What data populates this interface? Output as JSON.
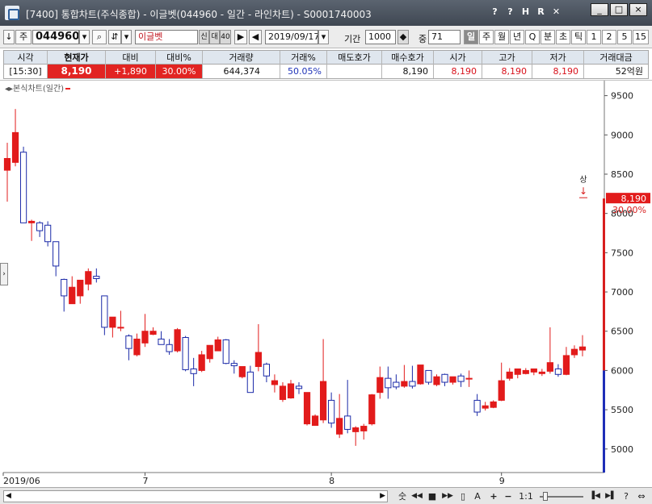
{
  "window": {
    "title": "[7400] 통합차트(주식종합) - 이글벳(044960 - 일간 - 라인차트) - S0001740003",
    "tools": [
      "?",
      "?",
      "H",
      "R",
      "✕"
    ],
    "controls": [
      "_",
      "□",
      "×"
    ]
  },
  "toolbar": {
    "arrow": "↓",
    "stock_type": "주",
    "code": "044960",
    "stock_name": "이글벳",
    "tags": [
      "신",
      "대",
      "40"
    ],
    "date": "2019/09/17",
    "period_label": "기간",
    "period_value": "1000",
    "count_label": "중",
    "count_value": "71",
    "periods": [
      "일",
      "주",
      "월",
      "년",
      "Q",
      "분",
      "초",
      "틱",
      "1",
      "2",
      "5",
      "15"
    ],
    "selected_period": "일"
  },
  "quote": {
    "headers": [
      "시각",
      "현재가",
      "대비",
      "대비%",
      "거래량",
      "거래%",
      "매도호가",
      "매수호가",
      "시가",
      "고가",
      "저가",
      "거래대금"
    ],
    "values": {
      "time": "[15:30]",
      "price": "8,190",
      "change": "+1,890",
      "change_pct": "30.00%",
      "volume": "644,374",
      "volume_pct": "50.05%",
      "ask": "",
      "bid": "8,190",
      "open": "8,190",
      "high": "8,190",
      "low": "8,190",
      "amount": "52억원"
    }
  },
  "chart_data": {
    "type": "candlestick",
    "series_label": "본식차트(일간)",
    "y_ticks": [
      5000,
      5500,
      6000,
      6500,
      7000,
      7500,
      8000,
      8500,
      9000,
      9500
    ],
    "ylim": [
      4700,
      9650
    ],
    "x_labels": [
      {
        "label": "2019/06",
        "index": 0
      },
      {
        "label": "7",
        "index": 17
      },
      {
        "label": "8",
        "index": 40
      },
      {
        "label": "9",
        "index": 61
      }
    ],
    "current_price": 8190,
    "current_price_label": "8,190",
    "current_change_label": "30.00%",
    "limit_label": "상",
    "limit_arrow": "↓",
    "candles": [
      {
        "o": 8550,
        "h": 8900,
        "l": 8150,
        "c": 8700
      },
      {
        "o": 8650,
        "h": 9330,
        "l": 8600,
        "c": 9030
      },
      {
        "o": 8780,
        "h": 8850,
        "l": 7880,
        "c": 7880
      },
      {
        "o": 7880,
        "h": 7920,
        "l": 7650,
        "c": 7900
      },
      {
        "o": 7880,
        "h": 7900,
        "l": 7700,
        "c": 7780
      },
      {
        "o": 7850,
        "h": 7900,
        "l": 7580,
        "c": 7640
      },
      {
        "o": 7640,
        "h": 7640,
        "l": 7200,
        "c": 7330
      },
      {
        "o": 7160,
        "h": 7170,
        "l": 6750,
        "c": 6950
      },
      {
        "o": 6850,
        "h": 7200,
        "l": 6850,
        "c": 7060
      },
      {
        "o": 6950,
        "h": 7150,
        "l": 6850,
        "c": 7150
      },
      {
        "o": 7100,
        "h": 7300,
        "l": 7020,
        "c": 7260
      },
      {
        "o": 7200,
        "h": 7300,
        "l": 7120,
        "c": 7170
      },
      {
        "o": 6950,
        "h": 6950,
        "l": 6450,
        "c": 6550
      },
      {
        "o": 6550,
        "h": 6680,
        "l": 6420,
        "c": 6680
      },
      {
        "o": 6550,
        "h": 6760,
        "l": 6500,
        "c": 6550
      },
      {
        "o": 6440,
        "h": 6460,
        "l": 6130,
        "c": 6280
      },
      {
        "o": 6200,
        "h": 6470,
        "l": 6180,
        "c": 6400
      },
      {
        "o": 6350,
        "h": 6720,
        "l": 6300,
        "c": 6500
      },
      {
        "o": 6460,
        "h": 6550,
        "l": 6450,
        "c": 6500
      },
      {
        "o": 6400,
        "h": 6500,
        "l": 6330,
        "c": 6330
      },
      {
        "o": 6330,
        "h": 6400,
        "l": 6200,
        "c": 6240
      },
      {
        "o": 6250,
        "h": 6540,
        "l": 6230,
        "c": 6520
      },
      {
        "o": 6420,
        "h": 6440,
        "l": 5990,
        "c": 6010
      },
      {
        "o": 6020,
        "h": 6160,
        "l": 5800,
        "c": 5960
      },
      {
        "o": 6000,
        "h": 6250,
        "l": 5980,
        "c": 6200
      },
      {
        "o": 6150,
        "h": 6320,
        "l": 6100,
        "c": 6320
      },
      {
        "o": 6250,
        "h": 6430,
        "l": 6250,
        "c": 6390
      },
      {
        "o": 6390,
        "h": 6400,
        "l": 6080,
        "c": 6090
      },
      {
        "o": 6090,
        "h": 6130,
        "l": 5960,
        "c": 6060
      },
      {
        "o": 5920,
        "h": 6050,
        "l": 5900,
        "c": 6050
      },
      {
        "o": 5980,
        "h": 6060,
        "l": 5720,
        "c": 5720
      },
      {
        "o": 6050,
        "h": 6590,
        "l": 5990,
        "c": 6230
      },
      {
        "o": 6080,
        "h": 6100,
        "l": 5850,
        "c": 5930
      },
      {
        "o": 5820,
        "h": 5950,
        "l": 5720,
        "c": 5870
      },
      {
        "o": 5630,
        "h": 5850,
        "l": 5600,
        "c": 5800
      },
      {
        "o": 5650,
        "h": 5880,
        "l": 5640,
        "c": 5830
      },
      {
        "o": 5800,
        "h": 5850,
        "l": 5700,
        "c": 5770
      },
      {
        "o": 5320,
        "h": 5720,
        "l": 5300,
        "c": 5720
      },
      {
        "o": 5300,
        "h": 5440,
        "l": 5300,
        "c": 5420
      },
      {
        "o": 5370,
        "h": 6400,
        "l": 5330,
        "c": 5860
      },
      {
        "o": 5620,
        "h": 5720,
        "l": 5270,
        "c": 5330
      },
      {
        "o": 5190,
        "h": 5700,
        "l": 5140,
        "c": 5390
      },
      {
        "o": 5420,
        "h": 5880,
        "l": 5200,
        "c": 5250
      },
      {
        "o": 5220,
        "h": 5290,
        "l": 5040,
        "c": 5270
      },
      {
        "o": 5230,
        "h": 5320,
        "l": 5120,
        "c": 5290
      },
      {
        "o": 5320,
        "h": 5700,
        "l": 5300,
        "c": 5690
      },
      {
        "o": 5720,
        "h": 6050,
        "l": 5640,
        "c": 5910
      },
      {
        "o": 5900,
        "h": 6050,
        "l": 5640,
        "c": 5780
      },
      {
        "o": 5850,
        "h": 5950,
        "l": 5760,
        "c": 5790
      },
      {
        "o": 5800,
        "h": 6070,
        "l": 5780,
        "c": 5860
      },
      {
        "o": 5860,
        "h": 6060,
        "l": 5770,
        "c": 5800
      },
      {
        "o": 5830,
        "h": 6070,
        "l": 5820,
        "c": 6070
      },
      {
        "o": 6000,
        "h": 6000,
        "l": 5820,
        "c": 5850
      },
      {
        "o": 5820,
        "h": 5950,
        "l": 5800,
        "c": 5920
      },
      {
        "o": 5950,
        "h": 5960,
        "l": 5800,
        "c": 5850
      },
      {
        "o": 5850,
        "h": 5920,
        "l": 5820,
        "c": 5920
      },
      {
        "o": 5930,
        "h": 5960,
        "l": 5790,
        "c": 5860
      },
      {
        "o": 5900,
        "h": 6000,
        "l": 5790,
        "c": 5900
      },
      {
        "o": 5620,
        "h": 5700,
        "l": 5420,
        "c": 5470
      },
      {
        "o": 5520,
        "h": 5600,
        "l": 5490,
        "c": 5550
      },
      {
        "o": 5530,
        "h": 5620,
        "l": 5520,
        "c": 5600
      },
      {
        "o": 5620,
        "h": 6100,
        "l": 5610,
        "c": 5870
      },
      {
        "o": 5900,
        "h": 6030,
        "l": 5870,
        "c": 5980
      },
      {
        "o": 5950,
        "h": 6020,
        "l": 5900,
        "c": 6020
      },
      {
        "o": 5960,
        "h": 6030,
        "l": 5950,
        "c": 6000
      },
      {
        "o": 5980,
        "h": 6020,
        "l": 5940,
        "c": 6020
      },
      {
        "o": 5960,
        "h": 6020,
        "l": 5930,
        "c": 5980
      },
      {
        "o": 5990,
        "h": 6550,
        "l": 5960,
        "c": 6100
      },
      {
        "o": 6020,
        "h": 6080,
        "l": 5920,
        "c": 5950
      },
      {
        "o": 5950,
        "h": 6300,
        "l": 5940,
        "c": 6190
      },
      {
        "o": 6200,
        "h": 6320,
        "l": 6160,
        "c": 6270
      },
      {
        "o": 6260,
        "h": 6450,
        "l": 6180,
        "c": 6300
      }
    ]
  },
  "bottom": {
    "tools": [
      "숫",
      "◀◀",
      "■",
      "▶▶",
      "▯",
      "A",
      "+",
      "−",
      "1:1",
      "▐◀",
      "▶▌",
      "?",
      "⇔"
    ]
  }
}
